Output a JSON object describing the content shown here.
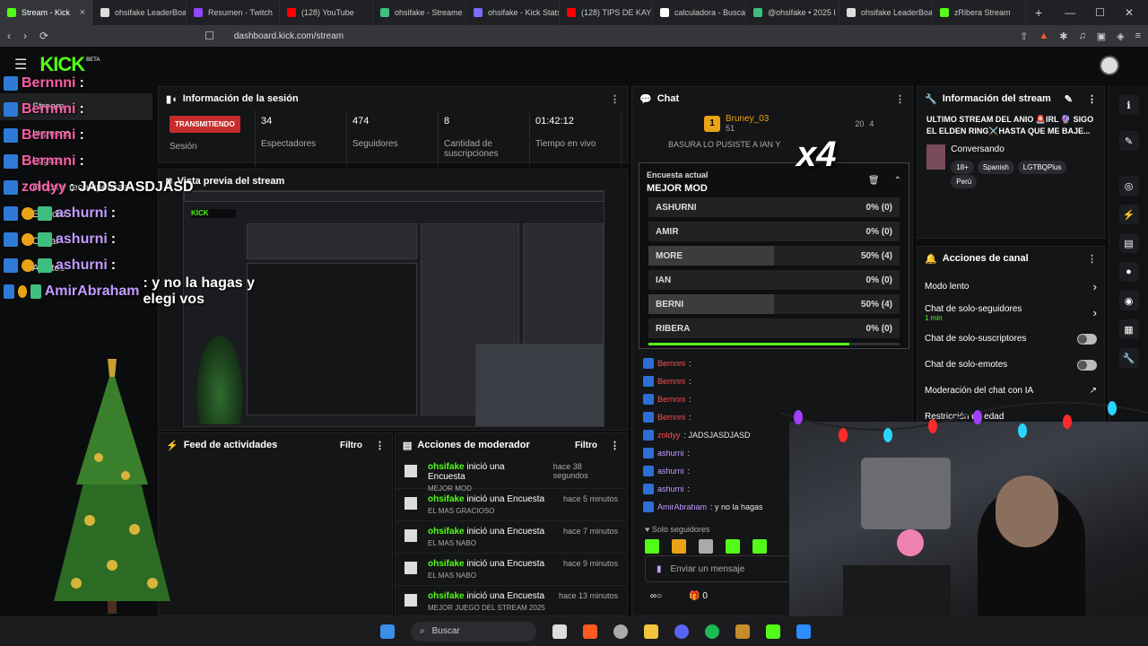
{
  "tabs": [
    {
      "title": "Stream - Kick",
      "color": "#53fc18"
    },
    {
      "title": "ohsifake LeaderBoa",
      "color": "#dddddd"
    },
    {
      "title": "Resumen - Twitch",
      "color": "#9146ff"
    },
    {
      "title": "(128) YouTube",
      "color": "#ff0000"
    },
    {
      "title": "ohsifake - Streame",
      "color": "#3fbf7f"
    },
    {
      "title": "ohsifake - Kick Stats",
      "color": "#7b6cff"
    },
    {
      "title": "(128) TIPS DE KAYD",
      "color": "#ff0000"
    },
    {
      "title": "calculadora - Busca",
      "color": "#ffffff"
    },
    {
      "title": "@ohsifake • 2025 I",
      "color": "#3fbf7f"
    },
    {
      "title": "ohsifake LeaderBoa",
      "color": "#dddddd"
    },
    {
      "title": "zRibera Stream",
      "color": "#53fc18"
    }
  ],
  "browser": {
    "url": "dashboard.kick.com/stream"
  },
  "nav": {
    "logo": "KICK",
    "beta": "BETA"
  },
  "sidebar": {
    "items": [
      "Stream",
      "Ingresos",
      "Logros",
      "Drops y recompensas",
      "Estudio",
      "Canal",
      "Ajustes"
    ]
  },
  "session": {
    "title": "Información de la sesión",
    "live_badge": "TRANSMITIENDO",
    "stats": [
      {
        "value": "",
        "label": "Sesión"
      },
      {
        "value": "34",
        "label": "Espectadores"
      },
      {
        "value": "474",
        "label": "Seguidores"
      },
      {
        "value": "8",
        "label": "Cantidad de suscripciones"
      },
      {
        "value": "01:42:12",
        "label": "Tiempo en vivo"
      }
    ]
  },
  "preview": {
    "title": "Vista previa del stream"
  },
  "activity": {
    "title": "Feed de actividades",
    "filter": "Filtro"
  },
  "modactions": {
    "title": "Acciones de moderador",
    "filter": "Filtro",
    "items": [
      {
        "user": "ohsifake",
        "action": "inició una Encuesta",
        "sub": "MEJOR MOD",
        "time": "hace 38 segundos"
      },
      {
        "user": "ohsifake",
        "action": "inició una Encuesta",
        "sub": "EL MAS GRACIOSO",
        "time": "hace 5 minutos"
      },
      {
        "user": "ohsifake",
        "action": "inició una Encuesta",
        "sub": "EL MAS NABO",
        "time": "hace 7 minutos"
      },
      {
        "user": "ohsifake",
        "action": "inició una Encuesta",
        "sub": "EL MAS NABO",
        "time": "hace 9 minutos"
      },
      {
        "user": "ohsifake",
        "action": "inició una Encuesta",
        "sub": "MEJOR JUEGO DEL STREAM 2025",
        "time": "hace 13 minutos"
      }
    ]
  },
  "chat": {
    "title": "Chat",
    "top_gifter": {
      "name": "Bruney_03",
      "count": "51",
      "rank": "1"
    },
    "top_others": [
      "20",
      "4"
    ],
    "pinned": "BASURA LO PUSISTE A IAN Y",
    "messages": [
      {
        "user": "Bernnni",
        "text": ":"
      },
      {
        "user": "Bernnni",
        "text": ":"
      },
      {
        "user": "Bernnni",
        "text": ":"
      },
      {
        "user": "Bernnni",
        "text": ":"
      },
      {
        "user": "zoldyy",
        "text": ": JADSJASDJASD"
      },
      {
        "user": "ashurni",
        "text": ":"
      },
      {
        "user": "ashurni",
        "text": ":"
      },
      {
        "user": "ashurni",
        "text": ":"
      },
      {
        "user": "AmirAbraham",
        "text": ": y no la hagas"
      }
    ],
    "followers_only": "Solo seguidores",
    "input_placeholder": "Enviar un mensaje",
    "viewer_count": "0"
  },
  "poll": {
    "label": "Encuesta actual",
    "question": "MEJOR MOD",
    "progress": 0.8,
    "options": [
      {
        "name": "ASHURNI",
        "pct": "0% (0)",
        "share": 0
      },
      {
        "name": "AMIR",
        "pct": "0% (0)",
        "share": 0
      },
      {
        "name": "MORE",
        "pct": "50% (4)",
        "share": 0.5
      },
      {
        "name": "IAN",
        "pct": "0% (0)",
        "share": 0
      },
      {
        "name": "BERNI",
        "pct": "50% (4)",
        "share": 0.5
      },
      {
        "name": "RIBERA",
        "pct": "0% (0)",
        "share": 0
      }
    ]
  },
  "streaminfo": {
    "title": "Información del stream",
    "stream_title": "ULTIMO STREAM DEL ANIO 🚨IRL 🔮 SIGO EL ELDEN RING⚔️HASTA QUE ME BAJE...",
    "category": "Conversando",
    "tags": [
      "18+",
      "Spanish",
      "LGTBQPlus",
      "Perú"
    ]
  },
  "channel": {
    "title": "Acciones de canal",
    "rows": [
      {
        "label": "Modo lento",
        "sub": "",
        "control": "chevron"
      },
      {
        "label": "Chat de solo-seguidores",
        "sub": "1 min",
        "control": "chevron"
      },
      {
        "label": "Chat de solo-suscriptores",
        "sub": "",
        "control": "toggle"
      },
      {
        "label": "Chat de solo-emotes",
        "sub": "",
        "control": "toggle"
      },
      {
        "label": "Moderación del chat con IA",
        "sub": "",
        "control": "link"
      },
      {
        "label": "Restricción de edad",
        "sub": "",
        "control": "none"
      }
    ]
  },
  "overlay": {
    "lines": [
      {
        "user": "Bernnni",
        "text": ":",
        "color": "#ff5ea8"
      },
      {
        "user": "Bernnni",
        "text": ":",
        "color": "#ff5ea8"
      },
      {
        "user": "Bernnni",
        "text": ":",
        "color": "#ff5ea8"
      },
      {
        "user": "Bernnni",
        "text": ":",
        "color": "#ff5ea8"
      },
      {
        "user": "zoldyy",
        "text": ": JADSJASDJASD",
        "color": "#ff5ea8"
      },
      {
        "user": "ashurni",
        "text": ":",
        "color": "#c49bff"
      },
      {
        "user": "ashurni",
        "text": ":",
        "color": "#c49bff"
      },
      {
        "user": "ashurni",
        "text": ":",
        "color": "#c49bff"
      },
      {
        "user": "AmirAbraham",
        "text": ": y no la hagas y elegi vos",
        "color": "#c49bff"
      }
    ],
    "gift_count": "x4"
  },
  "taskbar": {
    "search": "Buscar"
  }
}
